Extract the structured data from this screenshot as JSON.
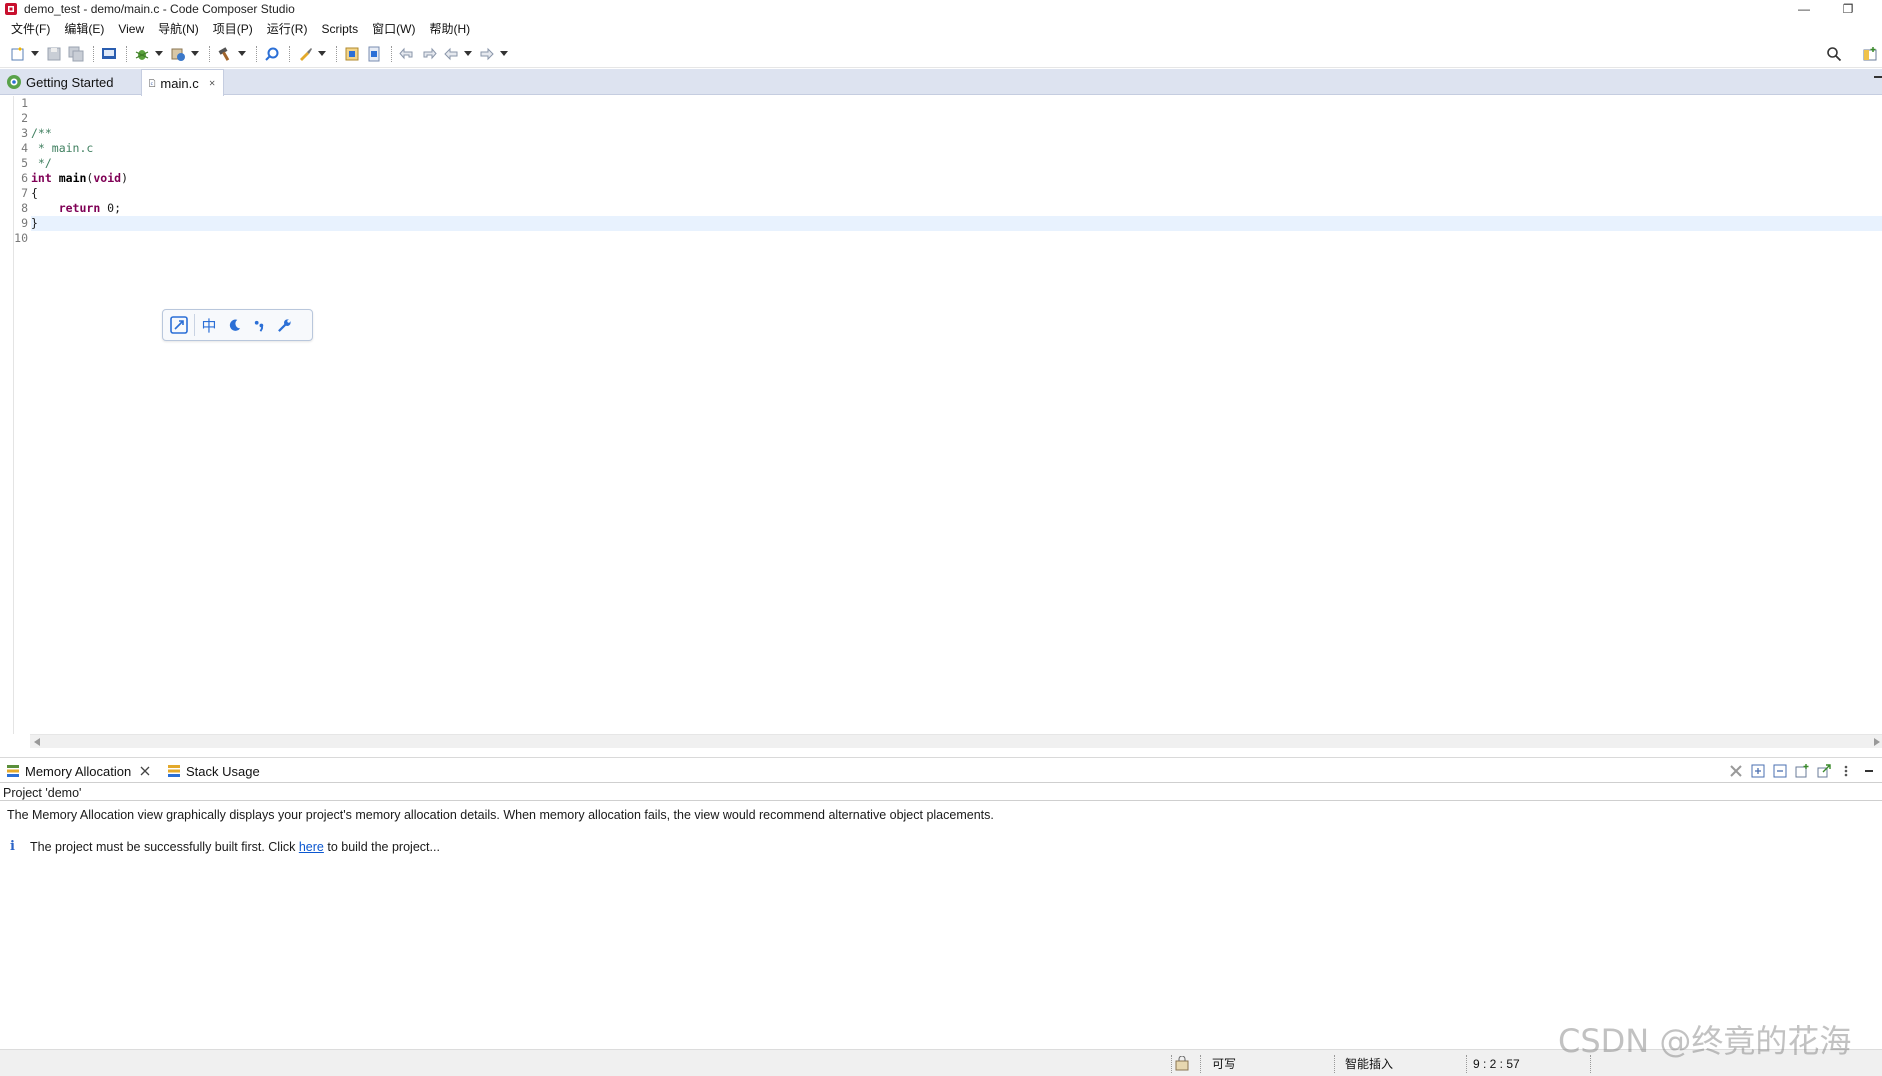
{
  "window": {
    "title": "demo_test - demo/main.c - Code Composer Studio",
    "minimize_glyph": "—",
    "maximize_glyph": "❐"
  },
  "menu": [
    "文件(F)",
    "编辑(E)",
    "View",
    "导航(N)",
    "项目(P)",
    "运行(R)",
    "Scripts",
    "窗口(W)",
    "帮助(H)"
  ],
  "toolbar": {
    "icons": [
      "new-icon",
      "save-icon",
      "save-all-icon",
      "terminal-icon",
      "debug-icon",
      "build-icon",
      "hammer-icon",
      "search-refs-icon",
      "brush-icon",
      "open-type-icon",
      "open-resource-icon",
      "prev-annotation-icon",
      "next-annotation-icon",
      "back-icon",
      "forward-icon",
      "search-icon",
      "perspective-icon"
    ]
  },
  "editor_tabs": [
    {
      "label": "Getting Started",
      "active": false
    },
    {
      "label": "main.c",
      "active": true
    }
  ],
  "code": {
    "line_numbers": [
      "1",
      "2",
      "3",
      "4",
      "5",
      "6",
      "7",
      "8",
      "9",
      "10"
    ],
    "lines": [
      "",
      "",
      "/**",
      " * main.c",
      " */",
      "int main(void)",
      "{",
      "    return 0;",
      "}",
      ""
    ],
    "current_line": 9
  },
  "ime_toolbar": {
    "mode": "中",
    "icons": [
      "ime-toggle-icon",
      "ime-moon-icon",
      "ime-punct-icon",
      "ime-settings-icon"
    ]
  },
  "bottom_tabs": [
    {
      "label": "Memory Allocation",
      "active": true
    },
    {
      "label": "Stack Usage",
      "active": false
    }
  ],
  "memory_panel": {
    "project_label": "Project 'demo'",
    "description": "The Memory Allocation view graphically displays your project's memory allocation details. When memory allocation fails, the view would recommend alternative object placements.",
    "info_prefix": "The project must be successfully built first. Click ",
    "info_link": "here",
    "info_suffix": " to build the project..."
  },
  "status": {
    "writable": "可写",
    "insert_mode": "智能插入",
    "position": "9 : 2 : 57"
  },
  "watermark": "CSDN @终竟的花海",
  "colors": {
    "accent": "#2b6fd6",
    "keyword": "#7f0055",
    "comment": "#3f7f5f",
    "tabbar": "#dde3f0",
    "current_line": "#e8f2fe"
  }
}
